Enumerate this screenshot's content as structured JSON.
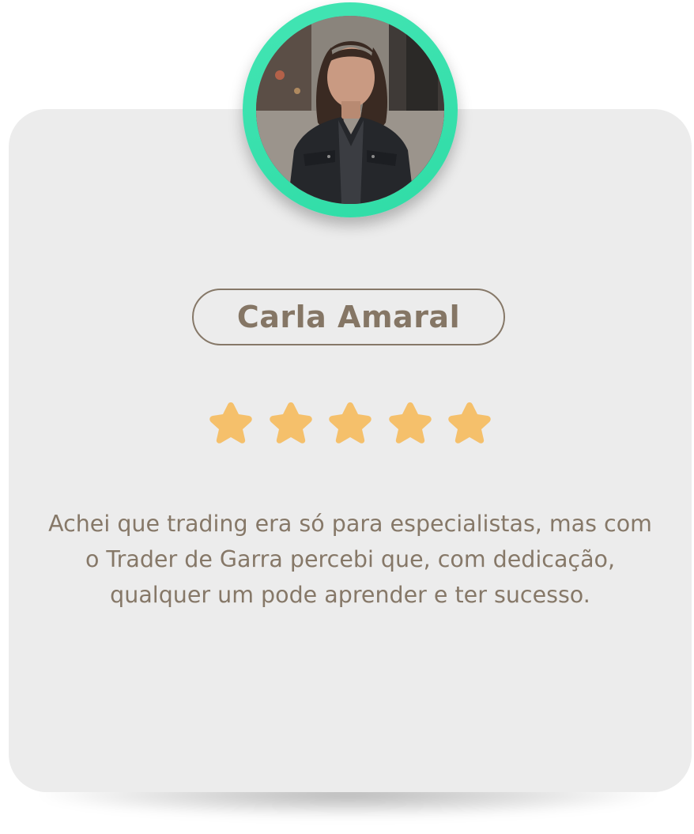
{
  "testimonial_card": {
    "avatar": {
      "alt": "Carla Amaral",
      "ring_color": "#3ee4b0"
    },
    "name": "Carla Amaral",
    "rating": {
      "value": 5,
      "max": 5,
      "star_color": "#f5c06b",
      "star_icon": "star-icon"
    },
    "quote": "Achei que trading era só para especialistas, mas com o Trader de Garra percebi que, com dedicação, qualquer um pode aprender e ter sucesso.",
    "colors": {
      "card_background": "#ececec",
      "text": "#867868"
    }
  }
}
